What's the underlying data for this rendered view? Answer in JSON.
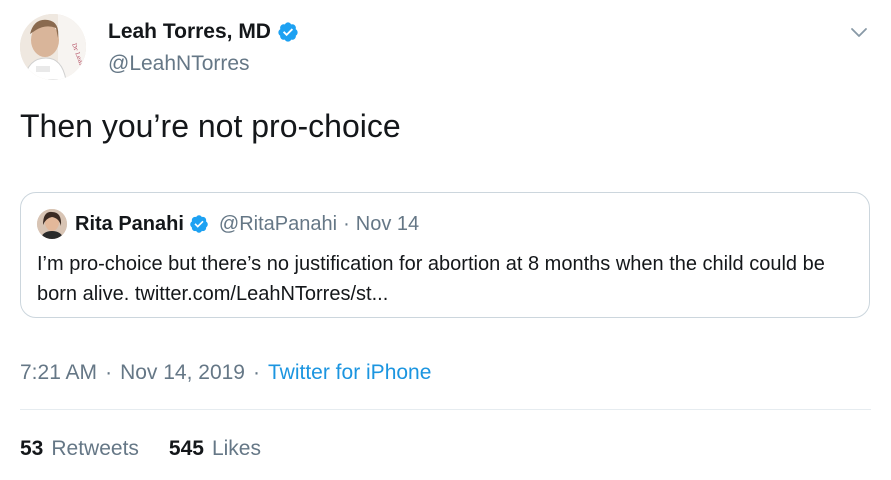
{
  "tweet": {
    "author": {
      "name": "Leah Torres, MD",
      "handle": "@LeahNTorres",
      "avatar_caption": "Dr. Leah Torres",
      "verified_color": "#1da1f2"
    },
    "text": "Then you’re not pro-choice",
    "quoted": {
      "name": "Rita Panahi",
      "handle": "@RitaPanahi",
      "separator": "·",
      "date": "Nov 14",
      "text": "I’m pro-choice but there’s no justification for abortion at 8 months  when the child could be born alive. twitter.com/LeahNTorres/st..."
    },
    "meta": {
      "time": "7:21 AM",
      "sep1": "·",
      "date": "Nov 14, 2019",
      "sep2": "·",
      "source": "Twitter for iPhone"
    },
    "stats": {
      "retweets_count": "53",
      "retweets_label": "Retweets",
      "likes_count": "545",
      "likes_label": "Likes"
    },
    "icons": {
      "verified": "verified-badge-icon",
      "caret": "chevron-down-icon"
    }
  }
}
